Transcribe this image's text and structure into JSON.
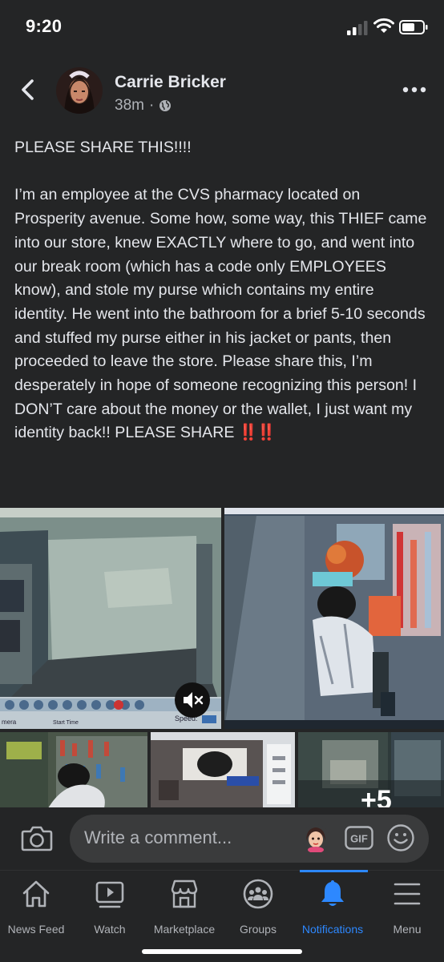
{
  "status_bar": {
    "time": "9:20"
  },
  "post": {
    "author": "Carrie Bricker",
    "time_ago": "38m",
    "dot": "·",
    "heading": "PLEASE SHARE THIS!!!!",
    "body": "I’m an employee at the CVS pharmacy located on Prosperity avenue. Some how, some way, this THIEF came into our store, knew EXACTLY where to go, and went into our break room (which has a code only EMPLOYEES know), and stole my purse which contains my entire identity. He went into the bathroom for a brief 5-10 seconds and stuffed my purse either in his jacket or pants, then proceeded to leave the store. Please share this, I’m desperately in hope of someone recognizing this person! I DON’T care about the money or the wallet, I just want my identity back!! PLEASE SHARE",
    "body_emoji": "‼️‼️",
    "more_photos_label": "+5",
    "photo_labels": {
      "speed": "Speed:",
      "start_time": "Start Time",
      "camera": "mera"
    }
  },
  "comment_bar": {
    "placeholder": "Write a comment...",
    "gif_label": "GIF"
  },
  "tabs": [
    {
      "label": "News Feed",
      "icon": "home-icon"
    },
    {
      "label": "Watch",
      "icon": "watch-icon"
    },
    {
      "label": "Marketplace",
      "icon": "marketplace-icon"
    },
    {
      "label": "Groups",
      "icon": "groups-icon"
    },
    {
      "label": "Notifications",
      "icon": "bell-icon",
      "active": true
    },
    {
      "label": "Menu",
      "icon": "menu-icon"
    }
  ],
  "colors": {
    "background": "#242526",
    "accent": "#2d88ff",
    "text": "#e4e6eb",
    "muted": "#b0b3b8"
  }
}
